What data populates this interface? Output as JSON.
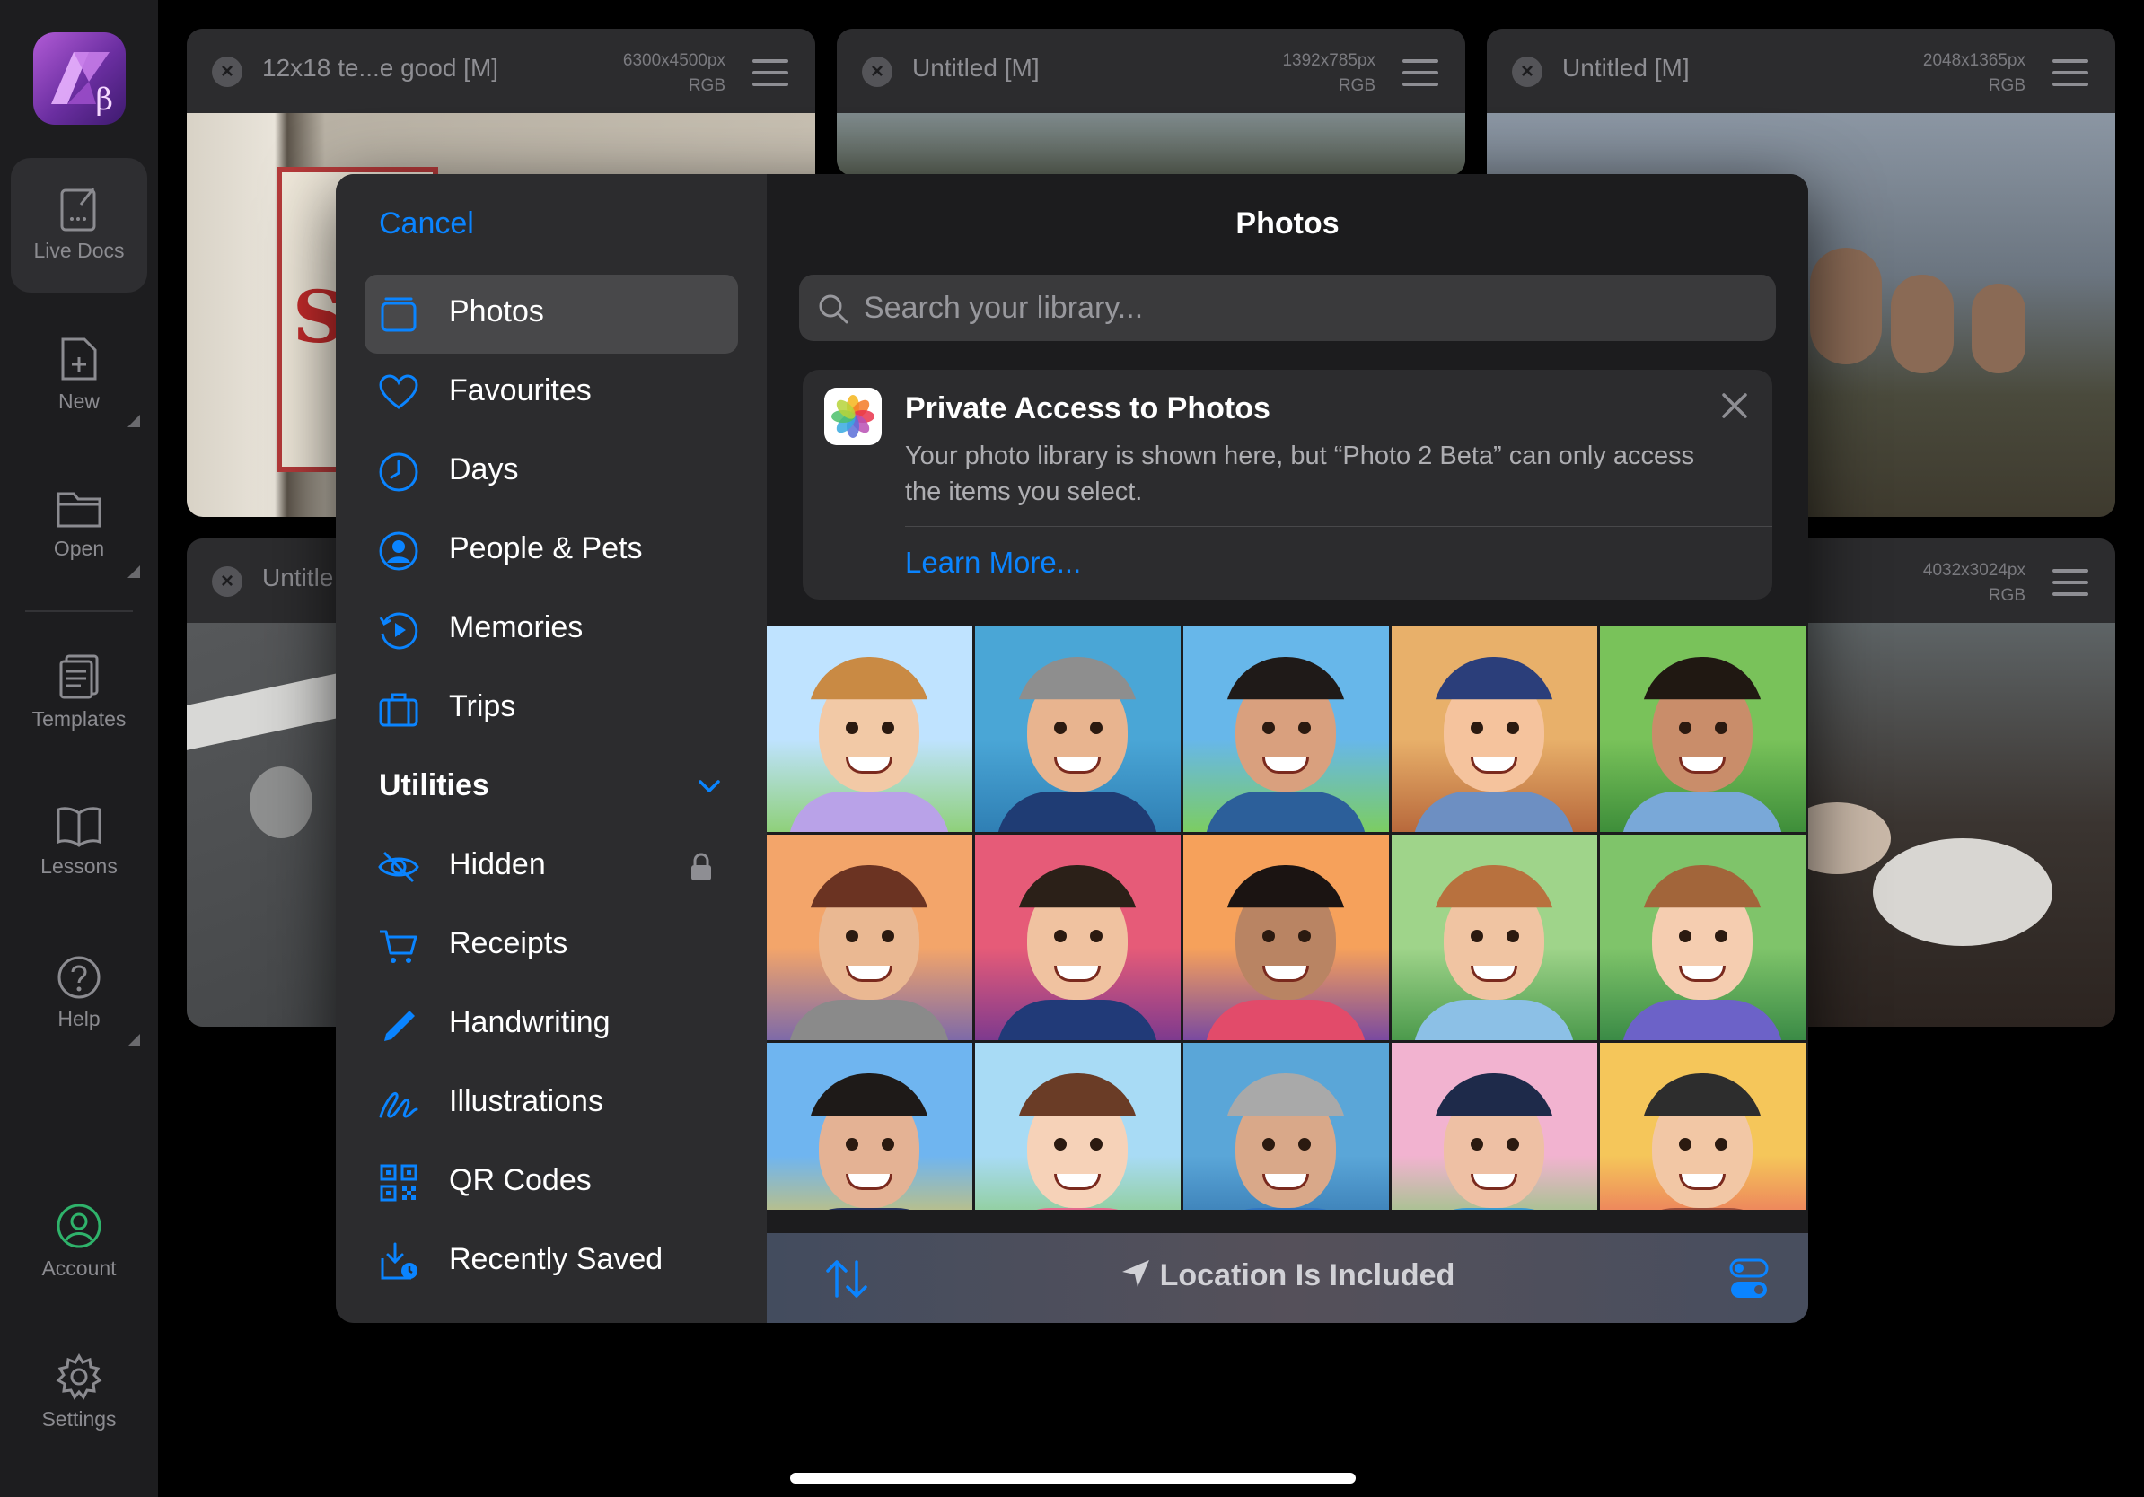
{
  "app_sidebar": {
    "items": [
      {
        "label": "Live Docs",
        "icon": "live-docs-icon"
      },
      {
        "label": "New",
        "icon": "new-document-icon"
      },
      {
        "label": "Open",
        "icon": "folder-icon"
      },
      {
        "label": "Templates",
        "icon": "templates-icon"
      },
      {
        "label": "Lessons",
        "icon": "book-icon"
      },
      {
        "label": "Help",
        "icon": "question-icon"
      },
      {
        "label": "Account",
        "icon": "account-icon"
      },
      {
        "label": "Settings",
        "icon": "gear-icon"
      }
    ],
    "logo_glyph": "β"
  },
  "documents": [
    {
      "title": "12x18 te...e good [M]",
      "dims": "6300x4500px",
      "mode": "RGB"
    },
    {
      "title": "Untitled [M]",
      "dims": "1392x785px",
      "mode": "RGB"
    },
    {
      "title": "Untitled [M]",
      "dims": "2048x1365px",
      "mode": "RGB"
    },
    {
      "title": "Untitle",
      "dims": "",
      "mode": ""
    },
    {
      "title": "",
      "dims": "4032x3024px",
      "mode": "RGB"
    }
  ],
  "picker": {
    "cancel_label": "Cancel",
    "title": "Photos",
    "search_placeholder": "Search your library...",
    "nav": [
      {
        "label": "Photos",
        "icon": "photos-stack-icon",
        "selected": true
      },
      {
        "label": "Favourites",
        "icon": "heart-icon"
      },
      {
        "label": "Days",
        "icon": "clock-icon"
      },
      {
        "label": "People & Pets",
        "icon": "person-circle-icon"
      },
      {
        "label": "Memories",
        "icon": "memories-play-icon"
      },
      {
        "label": "Trips",
        "icon": "suitcase-icon"
      }
    ],
    "utilities_header": "Utilities",
    "utilities": [
      {
        "label": "Hidden",
        "icon": "eye-slash-icon",
        "locked": true
      },
      {
        "label": "Receipts",
        "icon": "cart-icon"
      },
      {
        "label": "Handwriting",
        "icon": "pencil-icon"
      },
      {
        "label": "Illustrations",
        "icon": "scribble-icon"
      },
      {
        "label": "QR Codes",
        "icon": "qr-code-icon"
      },
      {
        "label": "Recently Saved",
        "icon": "tray-download-icon"
      }
    ],
    "notice": {
      "title": "Private Access to Photos",
      "body": "Your photo library is shown here, but “Photo 2 Beta” can only access the items you select.",
      "link": "Learn More..."
    },
    "footer": {
      "location_label": "Location Is Included"
    },
    "accent_color": "#0a84ff"
  }
}
